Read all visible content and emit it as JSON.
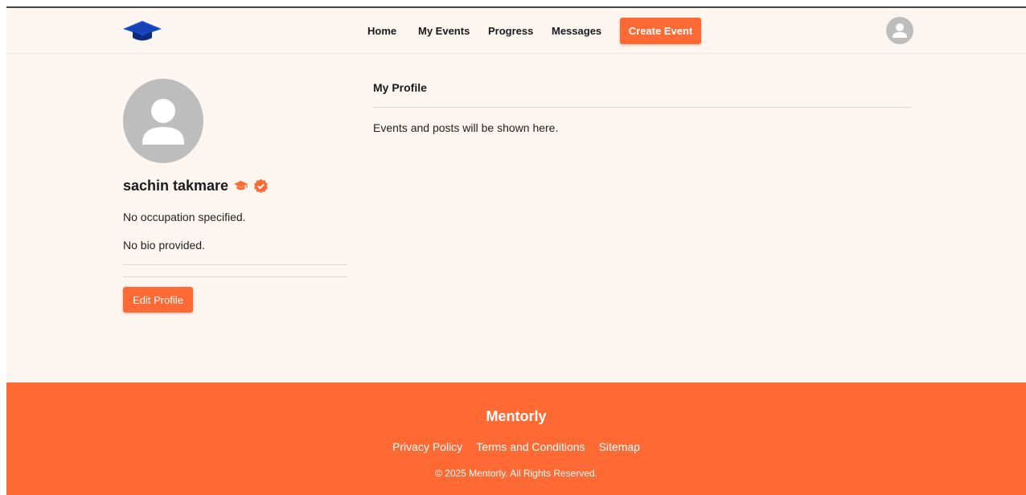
{
  "navbar": {
    "logo_icon": "graduation-cap-icon",
    "links": [
      {
        "label": "Home"
      },
      {
        "label": "My Events"
      },
      {
        "label": "Progress"
      },
      {
        "label": "Messages"
      }
    ],
    "create_event_label": "Create Event",
    "avatar_icon": "user-avatar-icon"
  },
  "profile": {
    "avatar_icon": "user-avatar-icon",
    "name": "sachin takmare",
    "badges": [
      "graduation-cap-icon",
      "verified-badge-icon"
    ],
    "occupation": "No occupation specified.",
    "bio": "No bio provided.",
    "edit_label": "Edit Profile"
  },
  "main": {
    "title": "My Profile",
    "placeholder": "Events and posts will be shown here."
  },
  "footer": {
    "brand": "Mentorly",
    "links": [
      "Privacy Policy",
      "Terms and Conditions",
      "Sitemap"
    ],
    "copyright": "© 2025 Mentorly. All Rights Reserved."
  },
  "colors": {
    "accent": "#ff6a34",
    "background": "#fdf6f0",
    "logo_blue": "#1a4fd0",
    "avatar_gray": "#bdbdbd"
  }
}
